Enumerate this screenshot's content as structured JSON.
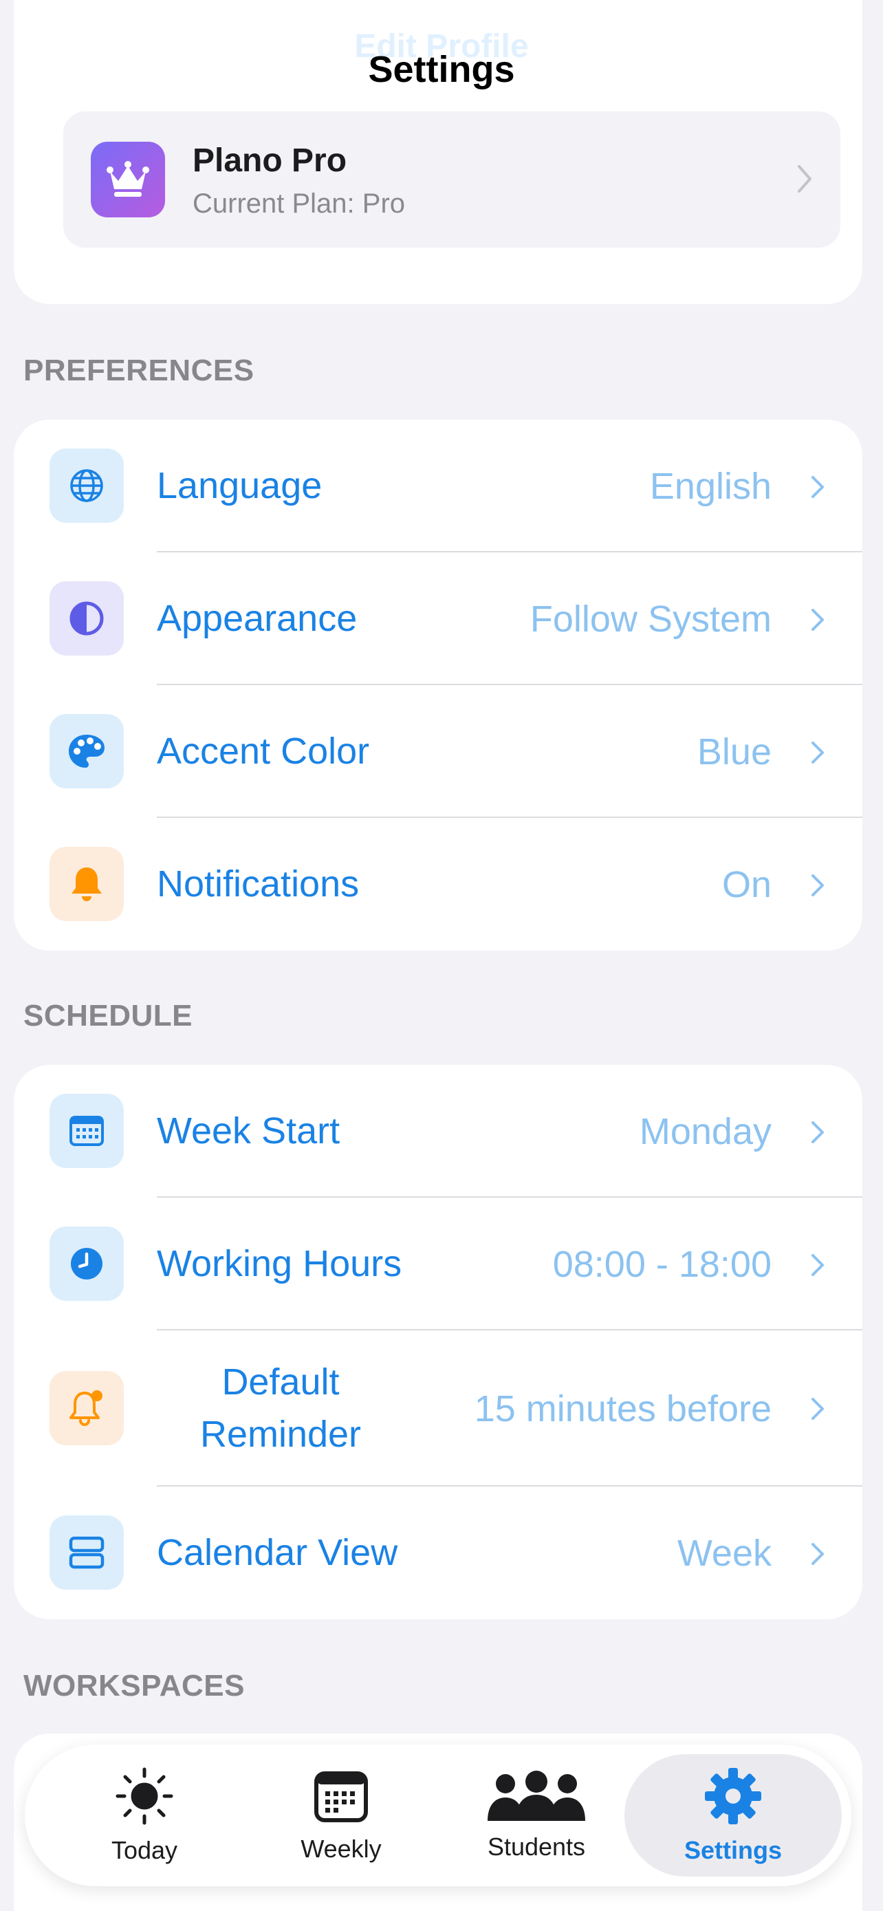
{
  "header": {
    "title": "Settings",
    "ghost_text": "Edit Profile"
  },
  "pro": {
    "title": "Plano Pro",
    "subtitle": "Current Plan: Pro",
    "icon": "crown-icon"
  },
  "sections": {
    "preferences": {
      "label": "PREFERENCES"
    },
    "schedule": {
      "label": "SCHEDULE"
    },
    "workspaces": {
      "label": "WORKSPACES"
    }
  },
  "preferences": [
    {
      "label": "Language",
      "value": "English",
      "icon": "globe-icon"
    },
    {
      "label": "Appearance",
      "value": "Follow System",
      "icon": "half-circle-icon"
    },
    {
      "label": "Accent Color",
      "value": "Blue",
      "icon": "palette-icon"
    },
    {
      "label": "Notifications",
      "value": "On",
      "icon": "bell-icon"
    }
  ],
  "schedule": [
    {
      "label": "Week Start",
      "value": "Monday",
      "icon": "calendar-icon"
    },
    {
      "label": "Working Hours",
      "value": "08:00 - 18:00",
      "icon": "clock-icon"
    },
    {
      "label": "Default Reminder",
      "value": "15 minutes before",
      "icon": "bell-badge-icon"
    },
    {
      "label": "Calendar View",
      "value": "Week",
      "icon": "view-icon"
    }
  ],
  "tabs": [
    {
      "label": "Today",
      "icon": "sun-icon",
      "active": false
    },
    {
      "label": "Weekly",
      "icon": "calendar-icon",
      "active": false
    },
    {
      "label": "Students",
      "icon": "people-icon",
      "active": false
    },
    {
      "label": "Settings",
      "icon": "gear-icon",
      "active": true
    }
  ],
  "colors": {
    "accent": "#1a82e4",
    "value_text": "#8cc2f0",
    "background": "#f2f2f7",
    "notification_orange": "#ff9500",
    "appearance_purple": "#5e5ce6"
  }
}
